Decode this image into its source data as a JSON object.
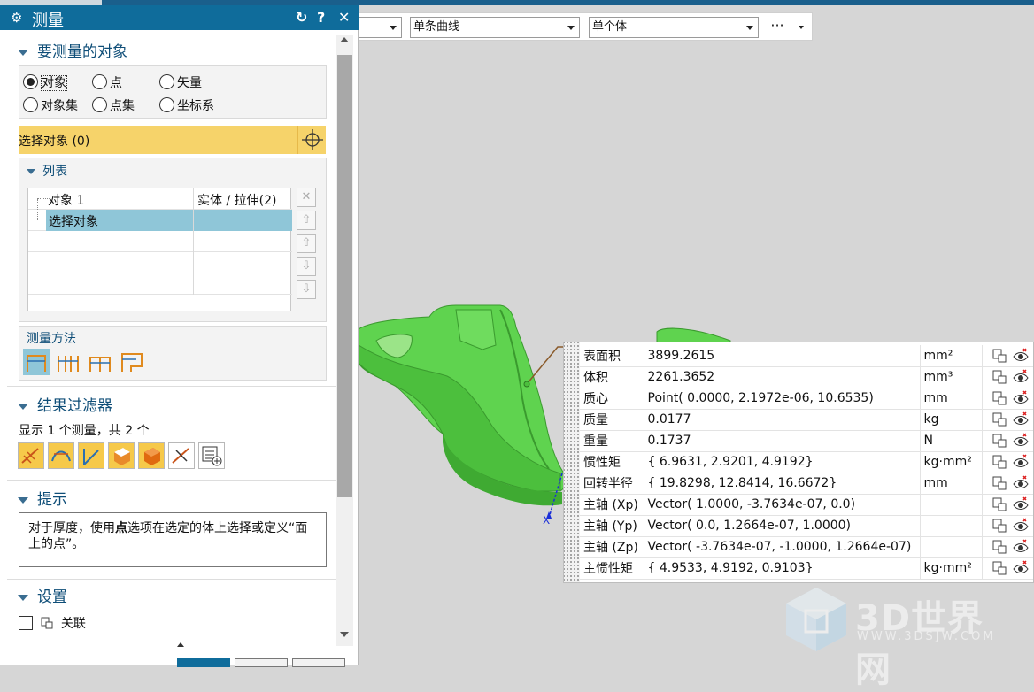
{
  "window": {
    "title": "测量"
  },
  "titlebar_icons": {
    "reset": "↻",
    "help": "?",
    "close": "✕"
  },
  "toolbar": {
    "filter1": "单条曲线",
    "filter2": "单个体",
    "more": "···"
  },
  "sections": {
    "objects": {
      "header": "要测量的对象",
      "radios": [
        {
          "label": "对象",
          "checked": true
        },
        {
          "label": "点",
          "checked": false
        },
        {
          "label": "矢量",
          "checked": false
        },
        {
          "label": "对象集",
          "checked": false
        },
        {
          "label": "点集",
          "checked": false
        },
        {
          "label": "坐标系",
          "checked": false
        }
      ],
      "select_label": "选择对象 (0)"
    },
    "list": {
      "header": "列表",
      "rows": [
        {
          "name": "对象 1",
          "type": "实体 / 拉伸(2)"
        },
        {
          "name": "选择对象",
          "type": ""
        }
      ]
    },
    "method": {
      "header": "测量方法"
    },
    "filter": {
      "header": "结果过滤器",
      "summary": "显示 1 个测量，共 2 个"
    },
    "hint": {
      "header": "提示",
      "text_a": "对于厚度，使用",
      "text_bold": "点",
      "text_b": "选项在选定的体上选择或定义“面上的点”。"
    },
    "settings": {
      "header": "设置",
      "associative_label": "关联"
    }
  },
  "results": [
    {
      "label": "表面积",
      "value": "3899.2615",
      "unit": "mm²"
    },
    {
      "label": "体积",
      "value": "2261.3652",
      "unit": "mm³"
    },
    {
      "label": "质心",
      "value": "Point( 0.0000, 2.1972e-06, 10.6535)",
      "unit": "mm"
    },
    {
      "label": "质量",
      "value": "0.0177",
      "unit": "kg"
    },
    {
      "label": "重量",
      "value": "0.1737",
      "unit": "N"
    },
    {
      "label": "惯性矩",
      "value": "{ 6.9631, 2.9201, 4.9192}",
      "unit": "kg·mm²"
    },
    {
      "label": "回转半径",
      "value": "{ 19.8298, 12.8414, 16.6672}",
      "unit": "mm"
    },
    {
      "label": "主轴 (Xp)",
      "value": "Vector( 1.0000, -3.7634e-07, 0.0)",
      "unit": ""
    },
    {
      "label": "主轴 (Yp)",
      "value": "Vector( 0.0, 1.2664e-07, 1.0000)",
      "unit": ""
    },
    {
      "label": "主轴 (Zp)",
      "value": "Vector( -3.7634e-07, -1.0000, 1.2664e-07)",
      "unit": ""
    },
    {
      "label": "主惯性矩",
      "value": "{ 4.9533, 4.9192, 0.9103}",
      "unit": "kg·mm²"
    }
  ],
  "viewport": {
    "axis_label": "X"
  },
  "watermark": {
    "brand": "3D世界网",
    "url": "WWW.3DSJW.COM"
  },
  "colors": {
    "accent": "#0f6c9b",
    "highlight": "#f6d36a",
    "model_green": "#5fd34f",
    "list_selected": "#8fc6d8"
  }
}
